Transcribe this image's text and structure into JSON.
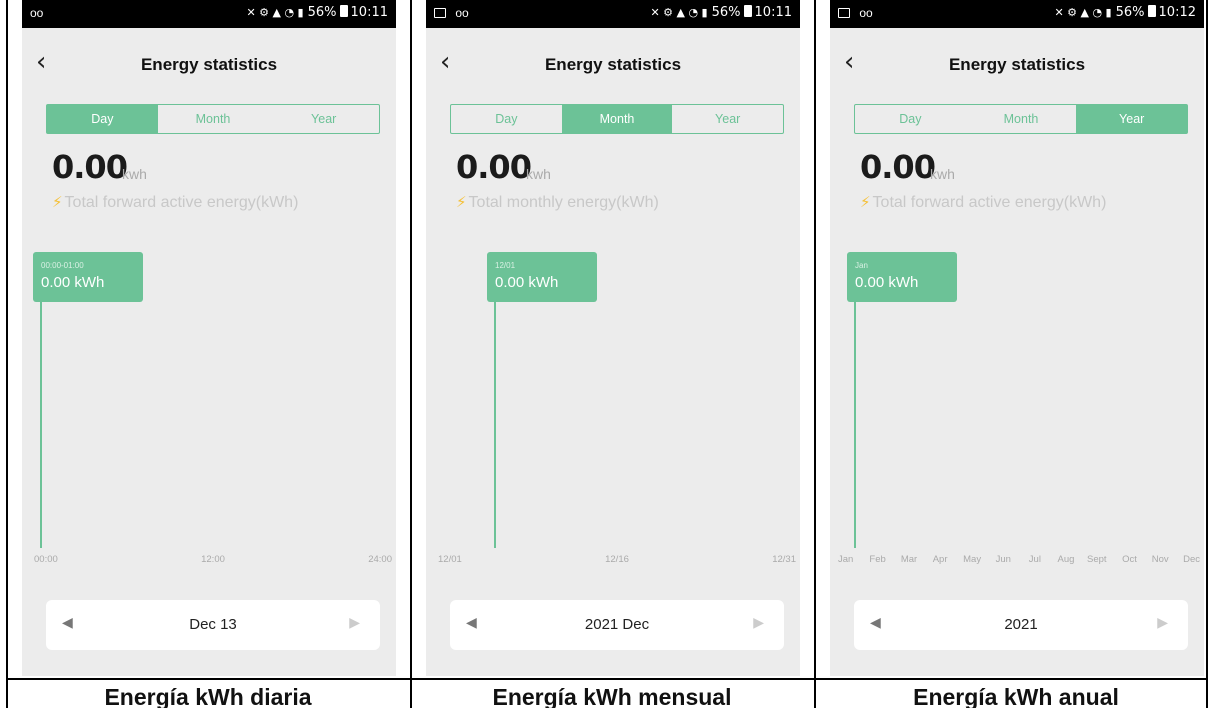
{
  "panels": [
    {
      "status": {
        "time": "10:11",
        "battery": "56%",
        "left_icons": "oo",
        "has_image_icon": false
      },
      "nav_title": "Energy statistics",
      "tabs": [
        "Day",
        "Month",
        "Year"
      ],
      "active_tab": 0,
      "value": "0.00",
      "unit": "kwh",
      "description": "Total forward active energy(kWh)",
      "tooltip": {
        "label": "00:00-01:00",
        "value": "0.00 kWh"
      },
      "x_ticks": [
        "00:00",
        "12:00",
        "24:00"
      ],
      "picker_value": "Dec 13",
      "caption": "Energía kWh diaria"
    },
    {
      "status": {
        "time": "10:11",
        "battery": "56%",
        "left_icons": "oo",
        "has_image_icon": true
      },
      "nav_title": "Energy statistics",
      "tabs": [
        "Day",
        "Month",
        "Year"
      ],
      "active_tab": 1,
      "value": "0.00",
      "unit": "kwh",
      "description": "Total monthly energy(kWh)",
      "tooltip": {
        "label": "12/01",
        "value": "0.00 kWh"
      },
      "x_ticks": [
        "12/01",
        "12/16",
        "12/31"
      ],
      "picker_value": "2021 Dec",
      "caption": "Energía kWh mensual"
    },
    {
      "status": {
        "time": "10:12",
        "battery": "56%",
        "left_icons": "oo",
        "has_image_icon": true
      },
      "nav_title": "Energy statistics",
      "tabs": [
        "Day",
        "Month",
        "Year"
      ],
      "active_tab": 2,
      "value": "0.00",
      "unit": "kwh",
      "description": "Total forward active energy(kWh)",
      "tooltip": {
        "label": "Jan",
        "value": "0.00 kWh"
      },
      "x_ticks": [
        "Jan",
        "Feb",
        "Mar",
        "Apr",
        "May",
        "Jun",
        "Jul",
        "Aug",
        "Sept",
        "Oct",
        "Nov",
        "Dec"
      ],
      "picker_value": "2021",
      "caption": "Energía kWh anual"
    }
  ],
  "icons": {
    "back": "chevron-left-icon",
    "prev": "triangle-left-icon",
    "next": "triangle-right-icon",
    "bolt": "lightning-bolt-icon"
  },
  "colors": {
    "accent": "#6cc297",
    "background": "#ececec",
    "bolt": "#f5c13a"
  }
}
